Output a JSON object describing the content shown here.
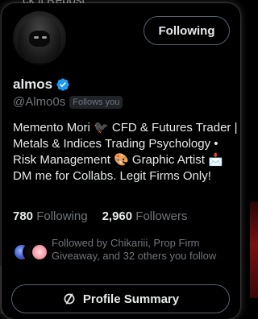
{
  "background": {
    "top_text": "ck ll Repost"
  },
  "profile": {
    "display_name": "almos",
    "handle": "@Almo0s",
    "follows_you_badge": "Follows you",
    "verified_icon": "verified-badge-icon",
    "accent_color": "#1d9bf0",
    "bio": "Memento Mori 🐦‍⬛ CFD & Futures Trader | Metals & Indices Trading Psychology • Risk Management 🎨 Graphic Artist 📩 DM me for Collabs. Legit Firms Only!"
  },
  "actions": {
    "following_label": "Following",
    "profile_summary_label": "Profile Summary",
    "profile_summary_icon": "sparkle-loop-icon"
  },
  "stats": {
    "following_count": "780",
    "following_label": "Following",
    "followers_count": "2,960",
    "followers_label": "Followers"
  },
  "followed_by": {
    "text": "Followed by Chikariii, Prop Firm Giveaway, and 32 others you follow"
  }
}
